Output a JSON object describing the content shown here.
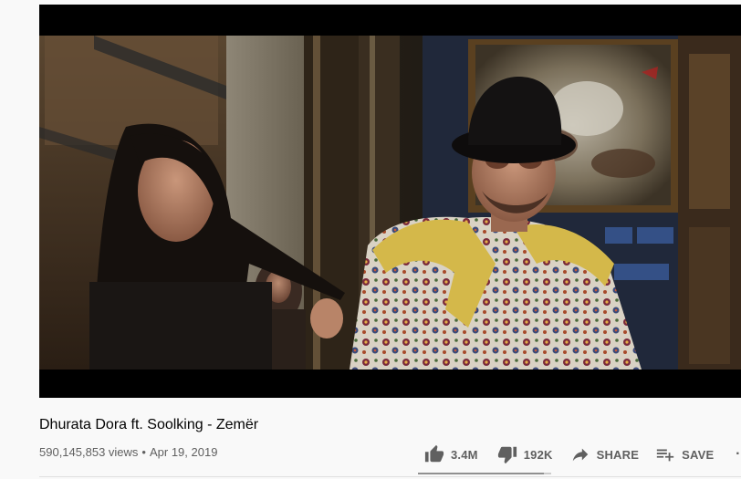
{
  "video": {
    "title": "Dhurata Dora ft. Soolking - Zemër",
    "views": "590,145,853 views",
    "separator": "•",
    "date": "Apr 19, 2019"
  },
  "actions": {
    "like_icon": "thumbs-up-icon",
    "like_count": "3.4M",
    "dislike_icon": "thumbs-down-icon",
    "dislike_count": "192K",
    "share_icon": "share-arrow-icon",
    "share_label": "SHARE",
    "save_icon": "playlist-add-icon",
    "save_label": "SAVE",
    "more_icon": "more-horizontal-icon",
    "more_label": "···"
  },
  "sentiment": {
    "like_fraction": 0.946
  },
  "colors": {
    "page_background": "#f9f9f9",
    "text_primary": "#030303",
    "text_secondary": "#606060",
    "icon": "#606060",
    "sentiment_like": "#909090",
    "sentiment_track": "#cccccc"
  }
}
